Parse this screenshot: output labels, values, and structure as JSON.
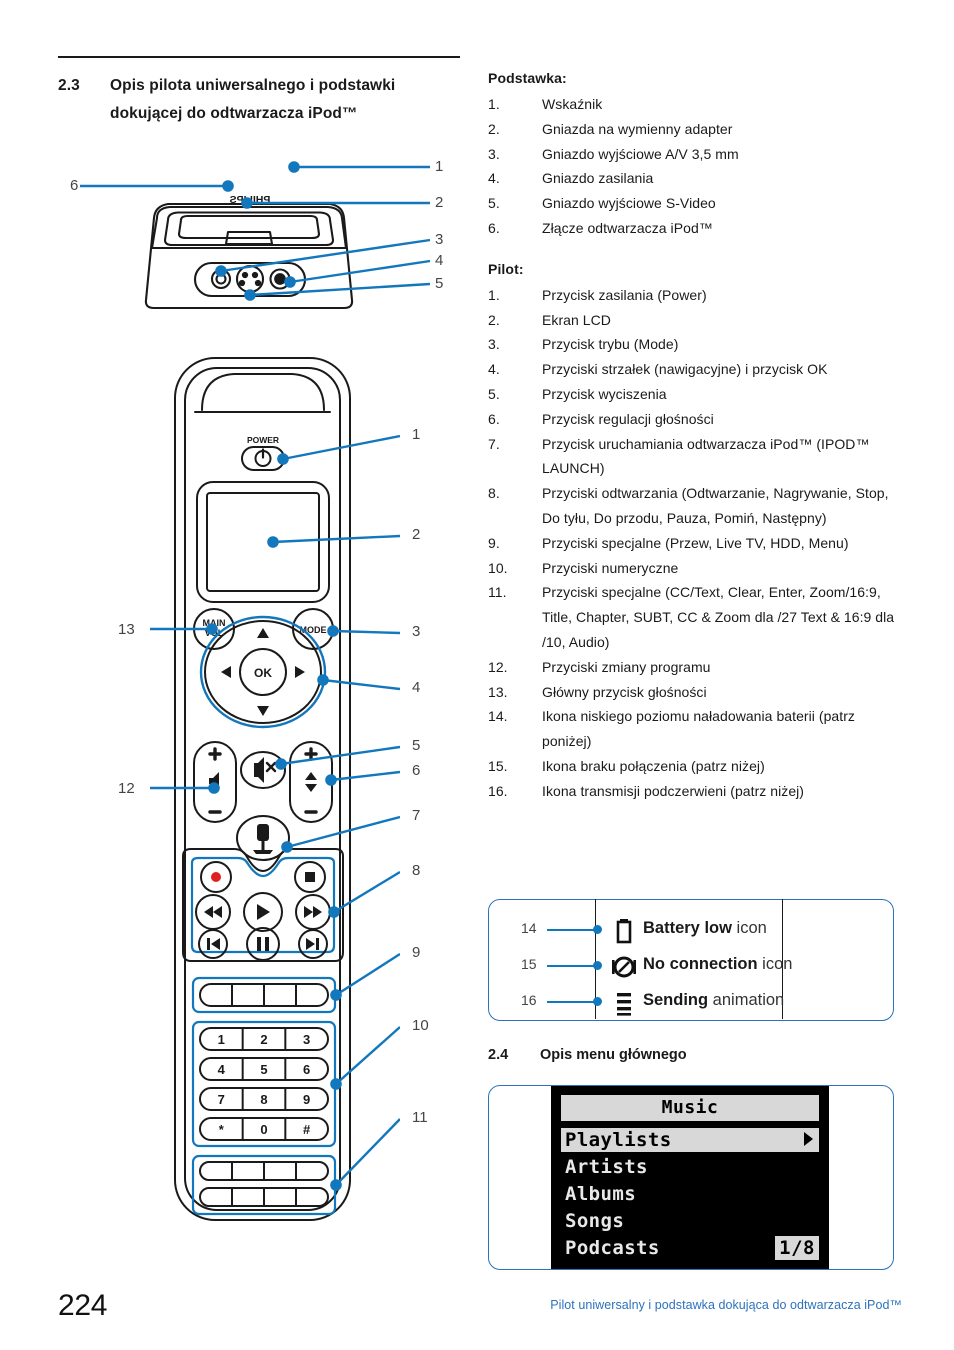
{
  "heading": {
    "number": "2.3",
    "title": "Opis pilota uniwersalnego i podstawki dokującej do odtwarzacza iPod™"
  },
  "dock_list": {
    "title": "Podstawka:",
    "items": [
      {
        "idx": "1.",
        "label": "Wskaźnik"
      },
      {
        "idx": "2.",
        "label": "Gniazda na wymienny adapter"
      },
      {
        "idx": "3.",
        "label": "Gniazdo wyjściowe A/V 3,5 mm"
      },
      {
        "idx": "4.",
        "label": "Gniazdo zasilania"
      },
      {
        "idx": "5.",
        "label": "Gniazdo wyjściowe S-Video"
      },
      {
        "idx": "6.",
        "label": "Złącze odtwarzacza iPod™"
      }
    ]
  },
  "remote_list": {
    "title": "Pilot:",
    "items": [
      {
        "idx": "1.",
        "label": "Przycisk zasilania (Power)"
      },
      {
        "idx": "2.",
        "label": "Ekran LCD"
      },
      {
        "idx": "3.",
        "label": "Przycisk trybu (Mode)"
      },
      {
        "idx": "4.",
        "label": "Przyciski strzałek (nawigacyjne) i przycisk OK"
      },
      {
        "idx": "5.",
        "label": "Przycisk wyciszenia"
      },
      {
        "idx": "6.",
        "label": "Przycisk regulacji głośności"
      },
      {
        "idx": "7.",
        "label": "Przycisk uruchamiania odtwarzacza iPod™ (IPOD™ LAUNCH)"
      },
      {
        "idx": "8.",
        "label": "Przyciski odtwarzania (Odtwarzanie, Nagrywanie, Stop, Do tyłu, Do przodu, Pauza, Pomiń, Następny)"
      },
      {
        "idx": "9.",
        "label": "Przyciski specjalne (Przew, Live TV, HDD, Menu)"
      },
      {
        "idx": "10.",
        "label": "Przyciski numeryczne"
      },
      {
        "idx": "11.",
        "label": "Przyciski specjalne (CC/Text, Clear, Enter, Zoom/16:9, Title, Chapter, SUBT, CC & Zoom dla /27 Text & 16:9 dla /10, Audio)"
      },
      {
        "idx": "12.",
        "label": "Przyciski zmiany programu"
      },
      {
        "idx": "13.",
        "label": "Główny przycisk głośności"
      },
      {
        "idx": "14.",
        "label": "Ikona niskiego poziomu naładowania baterii (patrz poniżej)"
      },
      {
        "idx": "15.",
        "label": "Ikona braku połączenia (patrz niżej)"
      },
      {
        "idx": "16.",
        "label": "Ikona transmisji podczerwieni (patrz niżej)"
      }
    ]
  },
  "legend": {
    "rows": [
      {
        "num": "14",
        "icon": "battery-low-icon",
        "bold": "Battery low",
        "rest": " icon"
      },
      {
        "num": "15",
        "icon": "no-connection-icon",
        "bold": "No connection",
        "rest": " icon"
      },
      {
        "num": "16",
        "icon": "sending-animation-icon",
        "bold": "Sending",
        "rest": " animation"
      }
    ]
  },
  "subheading_24": {
    "number": "2.4",
    "title": "Opis menu głównego"
  },
  "lcd": {
    "title": "Music",
    "items": [
      {
        "label": "Playlists",
        "selected": true
      },
      {
        "label": "Artists",
        "selected": false
      },
      {
        "label": "Albums",
        "selected": false
      },
      {
        "label": "Songs",
        "selected": false
      },
      {
        "label": "Podcasts",
        "selected": false
      }
    ],
    "page": "1/8"
  },
  "dock_diagram": {
    "brand": "PHILIPS",
    "callouts": [
      {
        "n": "1"
      },
      {
        "n": "2"
      },
      {
        "n": "3"
      },
      {
        "n": "4"
      },
      {
        "n": "5"
      },
      {
        "n": "6"
      }
    ]
  },
  "remote_diagram": {
    "power_label": "POWER",
    "main_vol_label_1": "MAIN",
    "main_vol_label_2": "VOL",
    "mode_label": "MODE",
    "ok_label": "OK",
    "keypad": [
      [
        "1",
        "2",
        "3"
      ],
      [
        "4",
        "5",
        "6"
      ],
      [
        "7",
        "8",
        "9"
      ],
      [
        "*",
        "0",
        "#"
      ]
    ],
    "callouts": [
      {
        "n": "1"
      },
      {
        "n": "2"
      },
      {
        "n": "3"
      },
      {
        "n": "4"
      },
      {
        "n": "5"
      },
      {
        "n": "6"
      },
      {
        "n": "7"
      },
      {
        "n": "8"
      },
      {
        "n": "9"
      },
      {
        "n": "10"
      },
      {
        "n": "11"
      },
      {
        "n": "12"
      },
      {
        "n": "13"
      }
    ]
  },
  "footer": {
    "page_number": "224",
    "text": "Pilot uniwersalny i podstawka dokująca do odtwarzacza iPod™"
  },
  "colors": {
    "accent_blue": "#1277bd",
    "footer_blue": "#2d72bd",
    "ink": "#1a1a1a"
  }
}
